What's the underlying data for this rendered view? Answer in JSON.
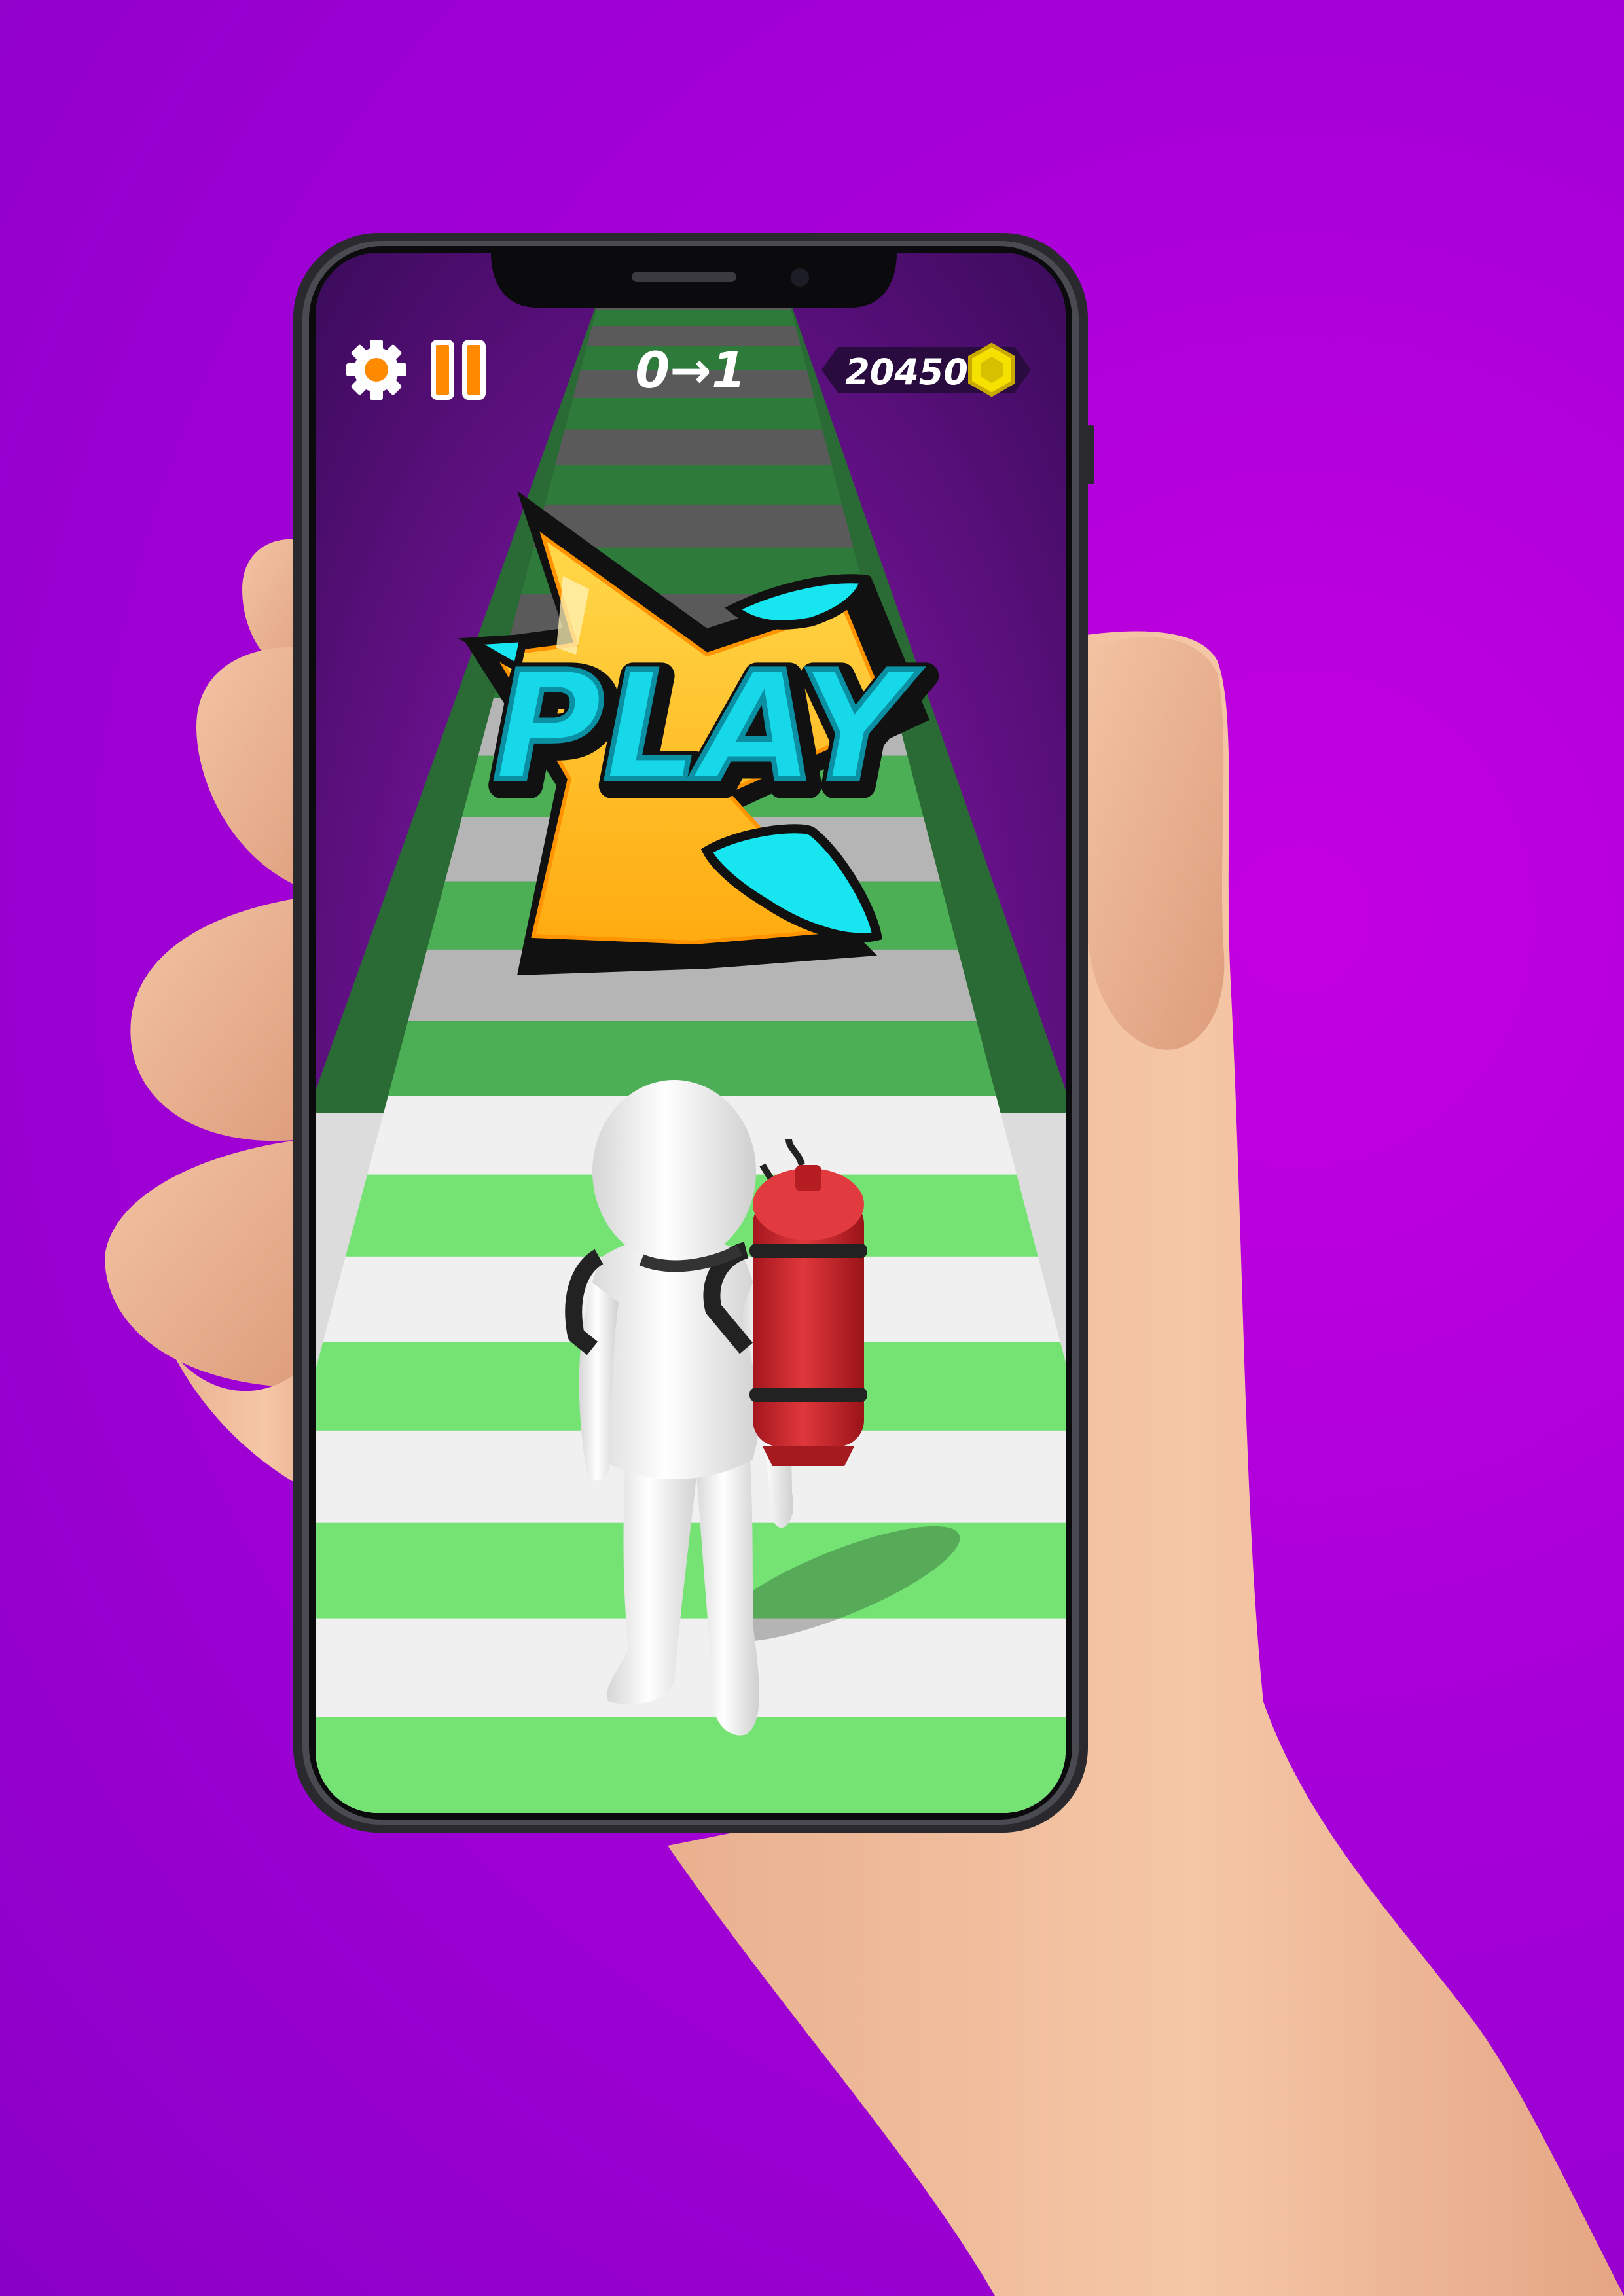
{
  "hud": {
    "level_progress": "0→1",
    "coins": "20450",
    "settings_icon": "gear-icon",
    "pause_icon": "pause-icon",
    "coin_icon": "hex-coin-icon"
  },
  "banner": {
    "label": "PLAY"
  },
  "colors": {
    "background": "#b000dc",
    "track_green": "#6fdc6f",
    "track_white": "#f2f2f2",
    "star_yellow": "#ffc21a",
    "accent_cyan": "#17e6f0",
    "pack_red": "#d8262c",
    "hud_orange": "#ff8a00"
  }
}
